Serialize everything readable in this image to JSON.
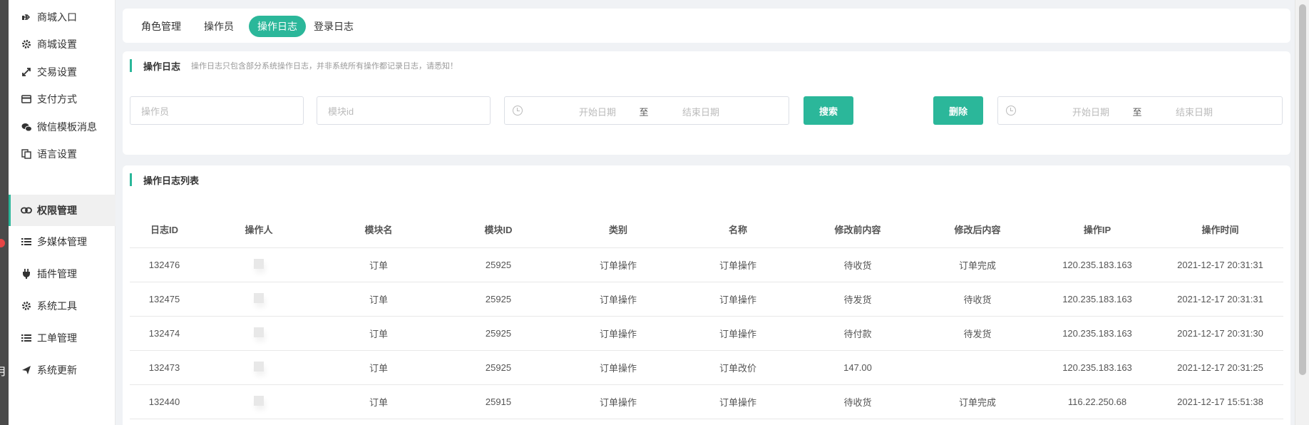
{
  "left_strip": {
    "cut_char": "月"
  },
  "sidebar": {
    "items": [
      {
        "label": "商城入口",
        "icon": "hand-pointer-icon"
      },
      {
        "label": "商城设置",
        "icon": "gear-icon"
      },
      {
        "label": "交易设置",
        "icon": "exchange-icon"
      },
      {
        "label": "支付方式",
        "icon": "credit-card-icon"
      },
      {
        "label": "微信模板消息",
        "icon": "wechat-icon"
      },
      {
        "label": "语言设置",
        "icon": "language-icon"
      },
      {
        "label": "权限管理",
        "icon": "link-icon",
        "active": true
      },
      {
        "label": "多媒体管理",
        "icon": "list-icon"
      },
      {
        "label": "插件管理",
        "icon": "plug-icon"
      },
      {
        "label": "系统工具",
        "icon": "gear-icon"
      },
      {
        "label": "工单管理",
        "icon": "list-icon"
      },
      {
        "label": "系统更新",
        "icon": "paper-plane-icon"
      }
    ]
  },
  "tabs": [
    {
      "label": "角色管理"
    },
    {
      "label": "操作员"
    },
    {
      "label": "操作日志",
      "active": true
    },
    {
      "label": "登录日志"
    }
  ],
  "filter": {
    "title": "操作日志",
    "hint": "操作日志只包含部分系统操作日志，并非系统所有操作都记录日志，请悉知！",
    "operator_placeholder": "操作员",
    "module_placeholder": "模块id",
    "start_placeholder": "开始日期",
    "range_sep": "至",
    "end_placeholder": "结束日期",
    "search_label": "搜索",
    "delete_label": "删除",
    "delete_start_placeholder": "开始日期",
    "delete_range_sep": "至",
    "delete_end_placeholder": "结束日期"
  },
  "list": {
    "title": "操作日志列表",
    "columns": [
      "日志ID",
      "操作人",
      "模块名",
      "模块ID",
      "类别",
      "名称",
      "修改前内容",
      "修改后内容",
      "操作IP",
      "操作时间"
    ],
    "rows": [
      [
        "132476",
        "",
        "订单",
        "25925",
        "订单操作",
        "订单操作",
        "待收货",
        "订单完成",
        "120.235.183.163",
        "2021-12-17 20:31:31"
      ],
      [
        "132475",
        "",
        "订单",
        "25925",
        "订单操作",
        "订单操作",
        "待发货",
        "待收货",
        "120.235.183.163",
        "2021-12-17 20:31:31"
      ],
      [
        "132474",
        "",
        "订单",
        "25925",
        "订单操作",
        "订单操作",
        "待付款",
        "待发货",
        "120.235.183.163",
        "2021-12-17 20:31:30"
      ],
      [
        "132473",
        "",
        "订单",
        "25925",
        "订单操作",
        "订单改价",
        "147.00",
        "",
        "120.235.183.163",
        "2021-12-17 20:31:25"
      ],
      [
        "132440",
        "",
        "订单",
        "25915",
        "订单操作",
        "订单操作",
        "待收货",
        "订单完成",
        "116.22.250.68",
        "2021-12-17 15:51:38"
      ]
    ]
  },
  "colors": {
    "accent": "#2bb79a",
    "danger_dot": "#e64545"
  }
}
